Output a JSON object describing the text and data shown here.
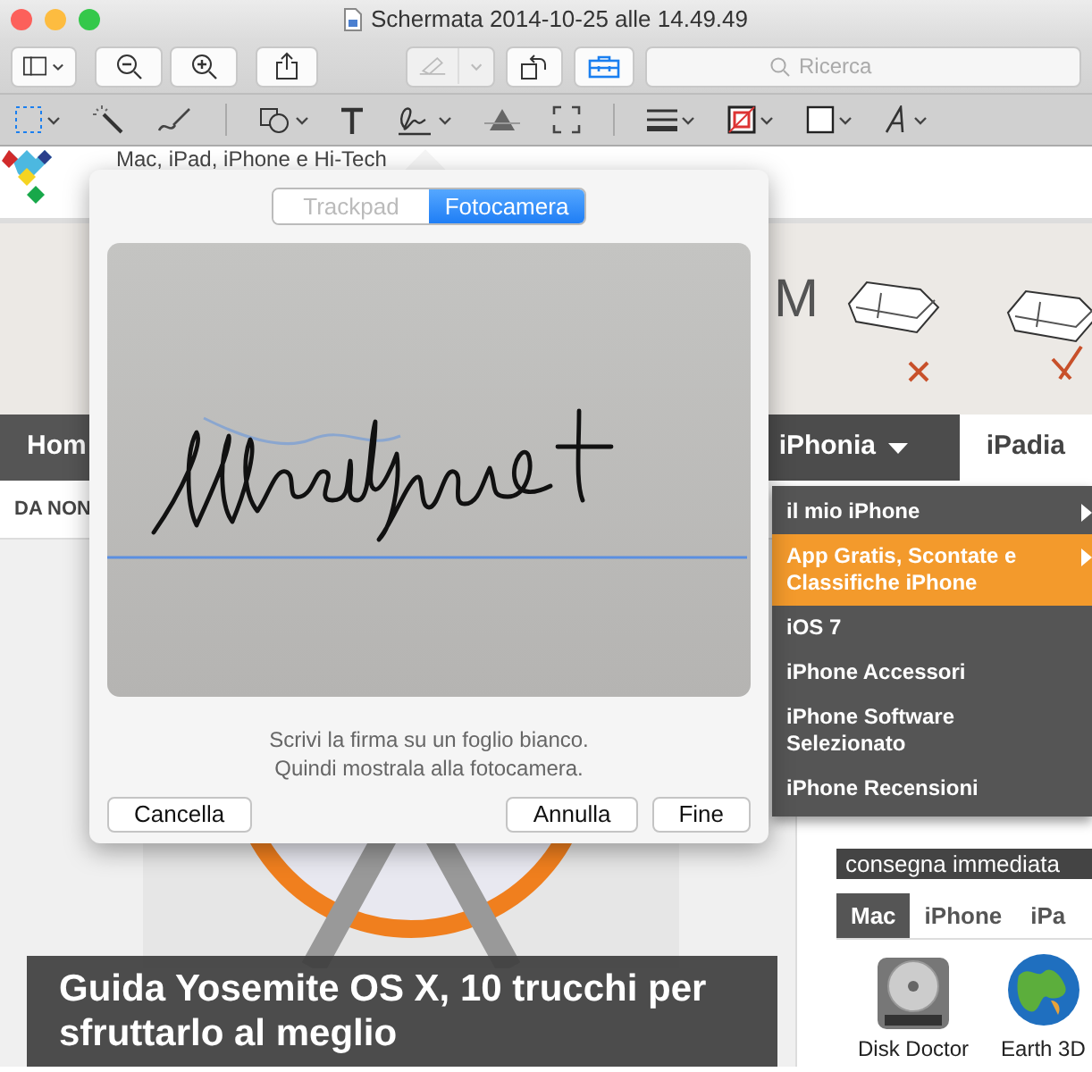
{
  "window": {
    "title": "Schermata 2014-10-25 alle 14.49.49"
  },
  "search": {
    "placeholder": "Ricerca"
  },
  "page": {
    "tagline": "Mac, iPad, iPhone e Hi-Tech",
    "ad_text": "M",
    "nav": [
      {
        "label": "Hom",
        "selected": false,
        "expanded": false
      },
      {
        "label": "iPhonia",
        "selected": false,
        "expanded": true
      },
      {
        "label": "iPadia",
        "selected": true,
        "expanded": false
      }
    ],
    "subnav_label": "DA NON",
    "menu": [
      {
        "label": "il mio iPhone",
        "selected": false,
        "submenu": true
      },
      {
        "label": "App Gratis, Scontate e Classifiche iPhone",
        "selected": true,
        "submenu": true
      },
      {
        "label": "iOS 7",
        "selected": false,
        "submenu": false
      },
      {
        "label": "iPhone Accessori",
        "selected": false,
        "submenu": false
      },
      {
        "label": "iPhone Software Selezionato",
        "selected": false,
        "submenu": false
      },
      {
        "label": "iPhone Recensioni",
        "selected": false,
        "submenu": false
      }
    ],
    "banner": "consegna immediata",
    "app_tabs": [
      {
        "label": "Mac",
        "selected": true
      },
      {
        "label": "iPhone",
        "selected": false
      },
      {
        "label": "iPa",
        "selected": false
      }
    ],
    "apps": [
      {
        "name": "Disk Doctor",
        "kind": "disk"
      },
      {
        "name": "Earth 3D",
        "kind": "globe"
      }
    ],
    "article_title": "Guida Yosemite OS X, 10 trucchi per sfruttarlo al meglio"
  },
  "signature": {
    "tabs": [
      {
        "label": "Trackpad",
        "selected": false
      },
      {
        "label": "Fotocamera",
        "selected": true
      }
    ],
    "hint": [
      "Scrivi la firma su un foglio bianco.",
      "Quindi mostrala alla fotocamera."
    ],
    "left_buttons": [
      "Cancella"
    ],
    "right_buttons": [
      "Annulla",
      "Fine"
    ]
  }
}
